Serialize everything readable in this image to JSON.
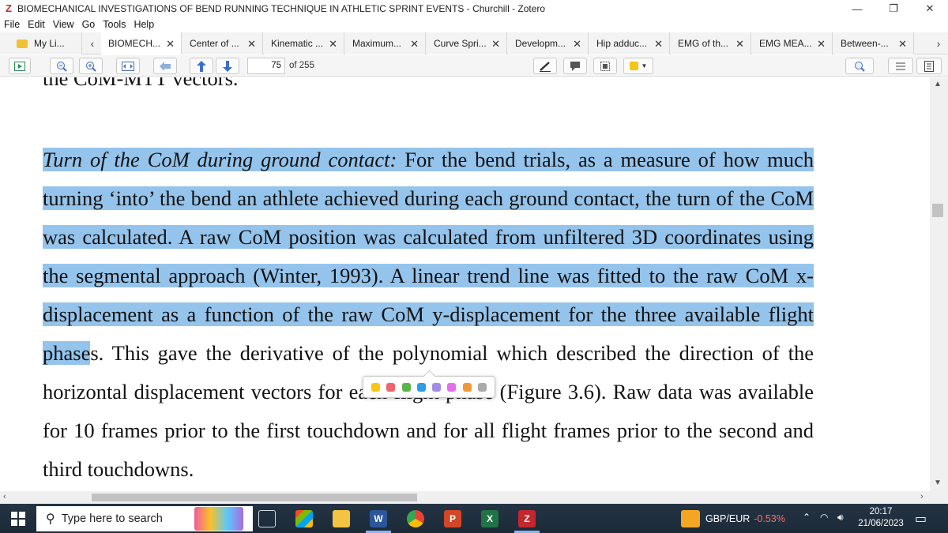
{
  "window": {
    "title": "BIOMECHANICAL INVESTIGATIONS OF BEND RUNNING TECHNIQUE IN ATHLETIC SPRINT EVENTS - Churchill - Zotero",
    "app_icon": "Z",
    "controls": {
      "minimize": "—",
      "restore": "❐",
      "close": "✕"
    }
  },
  "menu": [
    "File",
    "Edit",
    "View",
    "Go",
    "Tools",
    "Help"
  ],
  "tabs": {
    "library_label": "My Li...",
    "items": [
      {
        "label": "BIOMECH...",
        "active": true
      },
      {
        "label": "Center of ...",
        "active": false
      },
      {
        "label": "Kinematic ...",
        "active": false
      },
      {
        "label": "Maximum...",
        "active": false
      },
      {
        "label": "Curve Spri...",
        "active": false
      },
      {
        "label": "Developm...",
        "active": false
      },
      {
        "label": "Hip adduc...",
        "active": false
      },
      {
        "label": "EMG of th...",
        "active": false
      },
      {
        "label": "EMG MEA...",
        "active": false
      },
      {
        "label": "Between-...",
        "active": false
      }
    ],
    "close_glyph": "✕"
  },
  "toolbar": {
    "page_number": "75",
    "page_of": "of 255",
    "highlight_color": "#f5c518"
  },
  "document": {
    "cut_line": "the CoM-MTT vectors.",
    "para_italic": "Turn of the CoM during ground contact:",
    "para_highlighted": " For the bend trials, as a measure of how much turning ‘into’ the bend an athlete achieved during each ground contact, the turn of the CoM was calculated.  A raw CoM position was calculated from unfiltered 3D coordinates using the segmental approach (Winter, 1993).  A linear trend line was fitted to the raw CoM x-displacement as a function of the raw CoM y-displacement for the three available flight phase",
    "para_rest": "s.  This gave the derivative of the polynomial which described the direction of the horizontal displacement vectors for each flight phase (Figure 3.6).  Raw data was available for 10 frames prior to the first touchdown and for all flight frames prior to the second and third touchdowns.",
    "highlight_bg": "#94c4ec"
  },
  "color_picker": [
    "#f5c518",
    "#f0646a",
    "#5bb446",
    "#2e9ce6",
    "#a28ae5",
    "#e56eee",
    "#f19837",
    "#aaaaaa"
  ],
  "taskbar": {
    "search_placeholder": "Type here to search",
    "ticker_label": "GBP/EUR",
    "ticker_change": "-0.53%",
    "time": "20:17",
    "date": "21/06/2023"
  }
}
